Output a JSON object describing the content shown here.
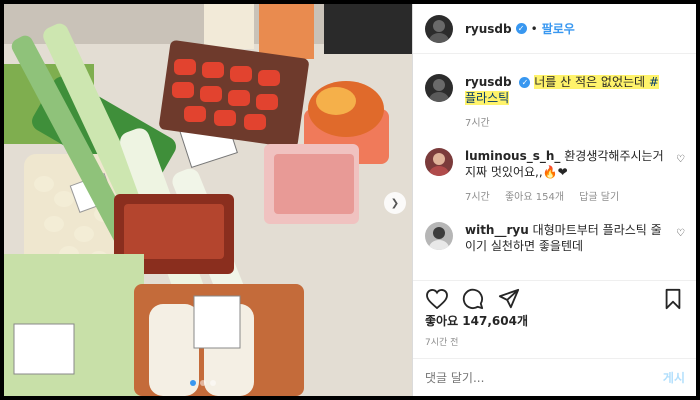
{
  "post": {
    "username": "ryusdb",
    "follow_label": "팔로우",
    "caption_part1": "너를 산 적은 없었는데 ",
    "caption_hashtag": "#플라스틱",
    "caption_time": "7시간"
  },
  "comments": [
    {
      "username": "luminous_s_h_",
      "text": "환경생각해주시는거 지짜 멋있어요,,",
      "emoji": "🔥❤",
      "time": "7시간",
      "likes": "좋아요 154개",
      "reply": "답글 달기"
    },
    {
      "username": "with__ryu",
      "text": "대형마트부터 플라스틱 줄이기 실천하면 좋을텐데"
    }
  ],
  "likes_text": "좋아요 147,604개",
  "post_time": "7시간 전",
  "comment_input": {
    "placeholder": "댓글 달기...",
    "post_label": "게시"
  },
  "colors": {
    "accent": "#3897f0",
    "highlight": "#fff36b"
  }
}
